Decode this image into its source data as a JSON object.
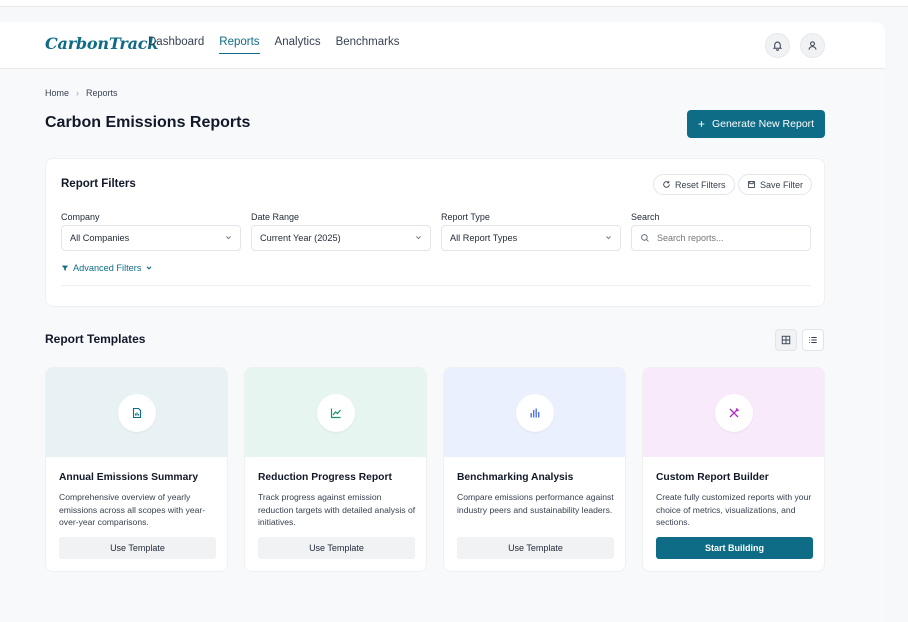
{
  "app": {
    "logo_text": "CarbonTrack"
  },
  "nav": {
    "links": [
      {
        "label": "Dashboard",
        "active": false
      },
      {
        "label": "Reports",
        "active": true
      },
      {
        "label": "Analytics",
        "active": false
      },
      {
        "label": "Benchmarks",
        "active": false
      }
    ],
    "icons": [
      "bell-icon",
      "user-icon"
    ]
  },
  "breadcrumb": {
    "home": "Home",
    "separator": "›",
    "current": "Reports"
  },
  "page": {
    "title": "Carbon Emissions Reports",
    "generate_button": "Generate New Report",
    "generate_icon": "+"
  },
  "filters": {
    "title": "Report Filters",
    "reset_label": "Reset Filters",
    "save_label": "Save Filter",
    "company_label": "Company",
    "company_value": "All Companies",
    "date_label": "Date Range",
    "date_value": "Current Year (2025)",
    "type_label": "Report Type",
    "type_value": "All Report Types",
    "search_label": "Search",
    "search_placeholder": "Search reports...",
    "advanced_label": "Advanced Filters"
  },
  "templates": {
    "section_title": "Report Templates",
    "cards": [
      {
        "title": "Annual Emissions Summary",
        "description": "Comprehensive overview of yearly emissions across all scopes with year-over-year comparisons.",
        "button": "Use Template",
        "icon": "document-chart-icon",
        "bg": "#e8f2f4",
        "icon_color": "#0e6c86"
      },
      {
        "title": "Reduction Progress Report",
        "description": "Track progress against emission reduction targets with detailed analysis of initiatives.",
        "button": "Use Template",
        "icon": "line-chart-icon",
        "bg": "#e6f5ef",
        "icon_color": "#16946b"
      },
      {
        "title": "Benchmarking Analysis",
        "description": "Compare emissions performance against industry peers and sustainability leaders.",
        "button": "Use Template",
        "icon": "bar-chart-icon",
        "bg": "#ebf0fe",
        "icon_color": "#4f74e8"
      },
      {
        "title": "Custom Report Builder",
        "description": "Create fully customized reports with your choice of metrics, visualizations, and sections.",
        "button": "Start Building",
        "icon": "tools-icon",
        "bg": "#f8e9fb",
        "icon_color": "#b02cc9"
      }
    ]
  },
  "colors": {
    "accent": "#0e6c86"
  }
}
